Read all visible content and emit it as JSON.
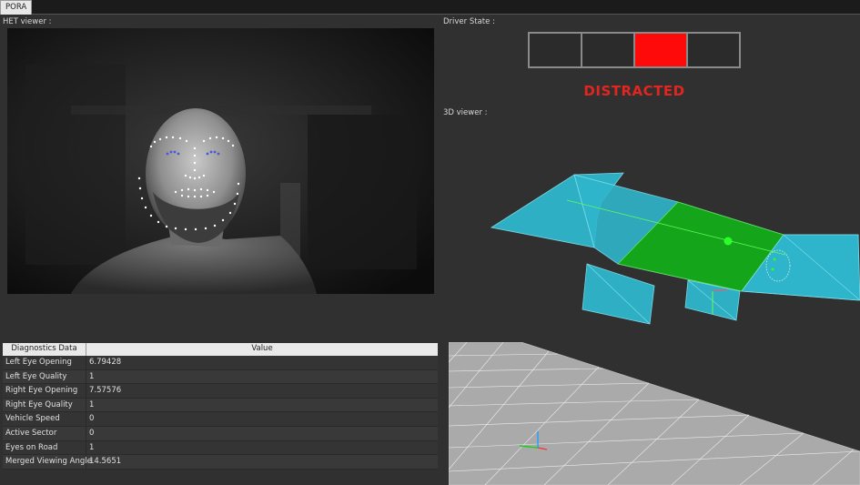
{
  "tabs": [
    {
      "label": "PORA"
    }
  ],
  "panels": {
    "het_label": "HET viewer :",
    "driver_state_label": "Driver State :",
    "viewer3d_label": "3D viewer :"
  },
  "driver_state": {
    "status_text": "DISTRACTED",
    "status_color": "#e0261e",
    "levels": 4,
    "active_level": 3,
    "active_color": "#ff0a0a"
  },
  "diagnostics": {
    "headers": [
      "Diagnostics Data",
      "Value"
    ],
    "rows": [
      {
        "name": "Left Eye Opening",
        "value": "6.79428"
      },
      {
        "name": "Left Eye Quality",
        "value": "1"
      },
      {
        "name": "Right Eye Opening",
        "value": "7.57576"
      },
      {
        "name": "Right Eye Quality",
        "value": "1"
      },
      {
        "name": "Vehicle Speed",
        "value": "0"
      },
      {
        "name": "Active Sector",
        "value": "0"
      },
      {
        "name": "Eyes on Road",
        "value": "1"
      },
      {
        "name": "Merged Viewing Angle",
        "value": "14.5651"
      }
    ]
  },
  "colors": {
    "sector_cyan": "#2fb6cc",
    "active_sector_green": "#15a51a",
    "gaze_dot": "#2aff2a"
  }
}
